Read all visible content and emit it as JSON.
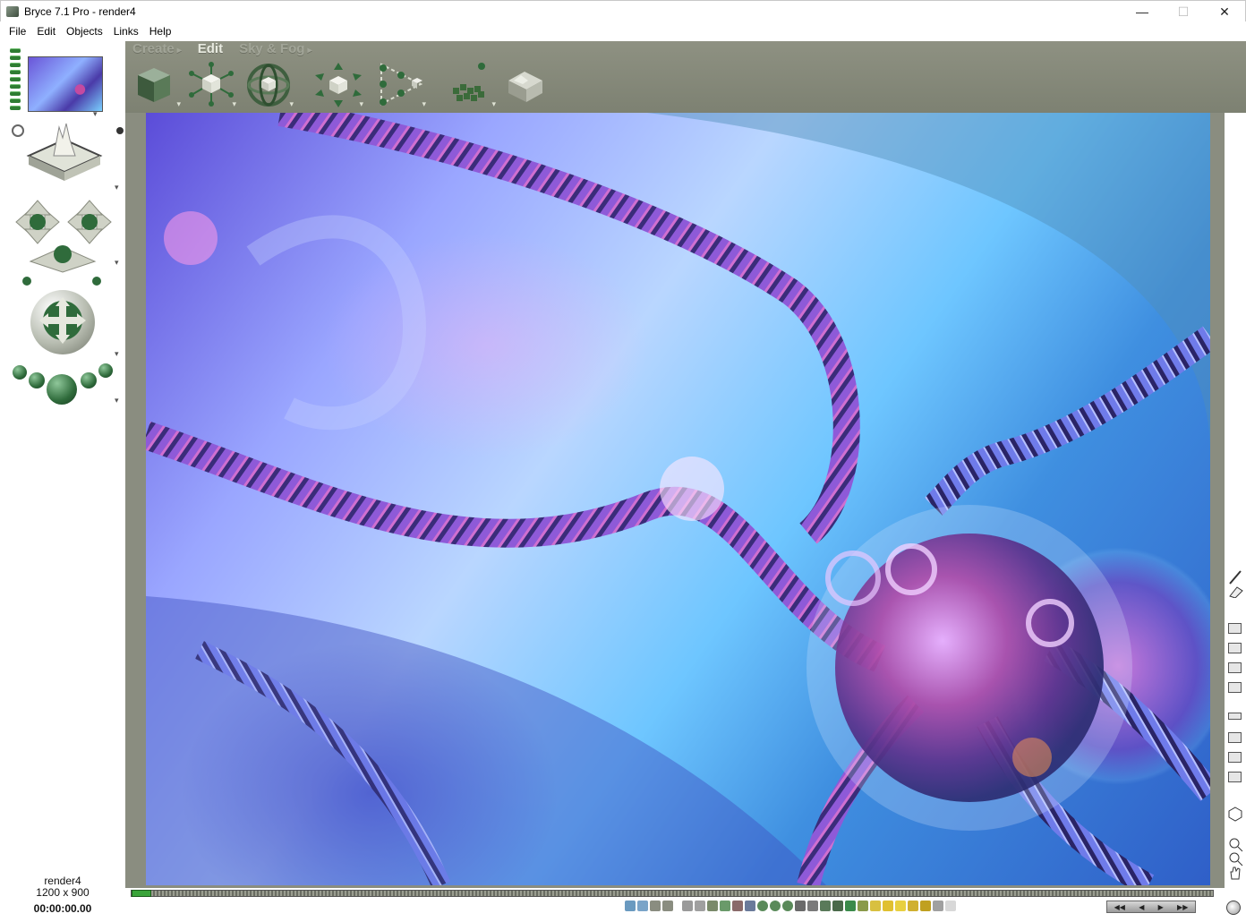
{
  "window": {
    "title": "Bryce 7.1 Pro - render4",
    "minimize": "—",
    "maximize": "☐",
    "close": "✕"
  },
  "menu": [
    "File",
    "Edit",
    "Objects",
    "Links",
    "Help"
  ],
  "palette_tabs": [
    {
      "label": "Create",
      "arrow": "▸"
    },
    {
      "label": "Edit",
      "arrow": ""
    },
    {
      "label": "Sky & Fog",
      "arrow": "▸"
    }
  ],
  "tool_drop_arrow": "▾",
  "status": {
    "document_name": "render4",
    "dimensions": "1200 x 900",
    "time": "00:00:00.00"
  },
  "playback": {
    "rewind": "◀◀",
    "back": "◀",
    "play": "▶",
    "forward": "▶▶"
  },
  "colors": {
    "toolbar_band": "#8e9182",
    "accent_green": "#2f6b3b",
    "timeline_green": "#3aa43a"
  },
  "icons": {
    "left_bar": [
      "view-leds",
      "scene-thumbnail",
      "view-control-icon",
      "camera-trackball-icon",
      "camera-cross-icon",
      "camera-direction-spheres"
    ],
    "edit_tools": [
      "material-icon",
      "resize-icon",
      "rotate-icon",
      "reposition-icon",
      "align-icon",
      "randomize-icon",
      "terrain-editor-icon"
    ],
    "right_bar": [
      "brush-icon",
      "eraser-icon",
      "render-mode-icons",
      "zoom-in-icon",
      "zoom-out-icon",
      "hand-pan-icon"
    ]
  }
}
